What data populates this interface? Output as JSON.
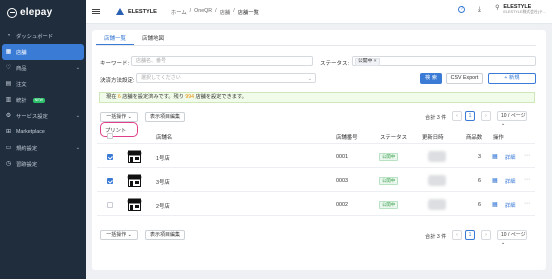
{
  "brand": {
    "logo_text": "elepay"
  },
  "sidebar": {
    "items": [
      {
        "label": "ダッシュボード",
        "icon": "dashboard-icon"
      },
      {
        "label": "店舗",
        "icon": "store-icon",
        "active": true
      },
      {
        "label": "商品",
        "icon": "product-icon",
        "chevron": true
      },
      {
        "label": "注文",
        "icon": "order-icon"
      },
      {
        "label": "統計",
        "icon": "chart-icon",
        "badge": "NEW"
      },
      {
        "label": "サービス設定",
        "icon": "settings-icon",
        "chevron": true
      },
      {
        "label": "Marketplace",
        "icon": "marketplace-icon"
      },
      {
        "label": "規約設定",
        "icon": "document-icon",
        "chevron": true
      },
      {
        "label": "習跡設定",
        "icon": "history-icon"
      }
    ]
  },
  "topbar": {
    "app_name": "ELESTYLE",
    "breadcrumb": [
      "ホーム",
      "/",
      "OneQR",
      "/",
      "店舗",
      "/",
      "店舗一覧"
    ],
    "user_name": "ELESTYLE",
    "user_sub": "ELESTYLE株式会社(テ..."
  },
  "tabs": [
    {
      "label": "店舗一覧",
      "active": true
    },
    {
      "label": "店舗地図"
    }
  ],
  "filters": {
    "keyword_label": "キーワード:",
    "keyword_placeholder": "店舗名、番号",
    "status_label": "ステータス:",
    "status_chip": "公開中 ×",
    "payment_label": "決済方法設定:",
    "payment_placeholder": "選択してください",
    "search_button": "検 索",
    "csv_button": "CSV Export",
    "new_button": "+ 新規"
  },
  "notice": {
    "prefix": "現在",
    "current": "6",
    "middle": "店舗を設定済みです。残り",
    "remaining": "994",
    "suffix": "店舗を設定できます。"
  },
  "toolbar": {
    "bulk_label": "一括操作 ⌄",
    "columns_label": "表示項目編集",
    "dropdown_item": "プリント",
    "total": "合計 3 件",
    "page": "1",
    "per_page": "10 / ページ ⌄"
  },
  "table": {
    "headers": [
      "店舗名",
      "店舗番号",
      "ステータス",
      "更新日時",
      "商品数",
      "操作"
    ],
    "rows": [
      {
        "checked": true,
        "name": "1号店",
        "number": "0001",
        "status": "公開中",
        "count": "3",
        "action": "詳細"
      },
      {
        "checked": true,
        "name": "3号店",
        "number": "0003",
        "status": "公開中",
        "count": "6",
        "action": "詳細"
      },
      {
        "checked": false,
        "name": "2号店",
        "number": "0002",
        "status": "公開中",
        "count": "6",
        "action": "詳細"
      }
    ]
  },
  "footer": {
    "bulk_label": "一括操作 ⌄",
    "columns_label": "表示項目編集",
    "total": "合計 3 件",
    "page": "1",
    "per_page": "10 / ページ ⌄"
  },
  "colors": {
    "sidebar": "#1f2d3d",
    "accent": "#3a7bd5",
    "highlight": "#e0408a",
    "status_green": "#2f9e44"
  }
}
